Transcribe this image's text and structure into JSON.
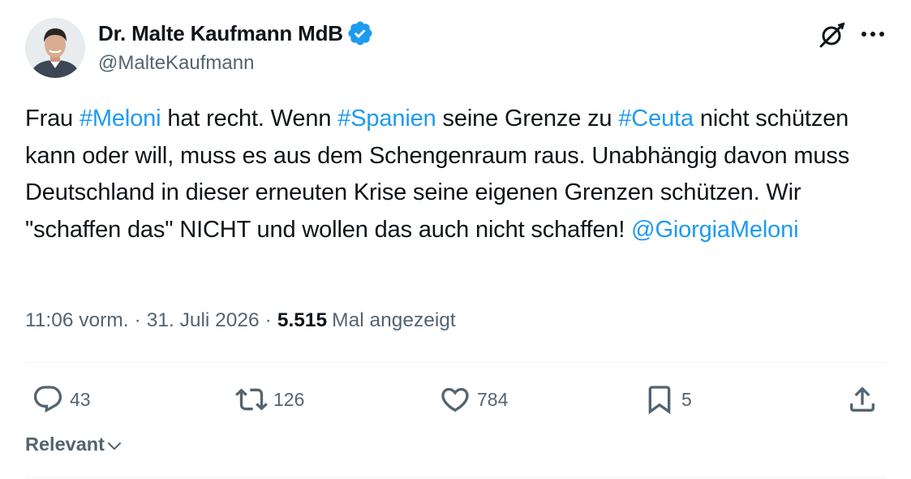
{
  "author": {
    "display_name": "Dr. Malte Kaufmann MdB",
    "handle": "@MalteKaufmann",
    "verified_icon": "verified-badge-icon"
  },
  "header_actions": {
    "grok_icon": "grok-icon",
    "more_icon": "more-options-icon"
  },
  "tweet": {
    "segments": [
      {
        "text": "Frau ",
        "type": "text"
      },
      {
        "text": "#Meloni",
        "type": "hashtag"
      },
      {
        "text": " hat recht. Wenn ",
        "type": "text"
      },
      {
        "text": "#Spanien",
        "type": "hashtag"
      },
      {
        "text": " seine Grenze zu ",
        "type": "text"
      },
      {
        "text": "#Ceuta",
        "type": "hashtag"
      },
      {
        "text": " nicht schützen kann oder will, muss es aus dem Schengenraum raus. Unabhängig davon muss Deutschland in dieser erneuten Krise seine eigenen Grenzen schützen. Wir \"schaffen das\" NICHT und wollen das auch nicht schaffen! ",
        "type": "text"
      },
      {
        "text": "@GiorgiaMeloni",
        "type": "mention"
      }
    ]
  },
  "meta": {
    "time": "11:06 vorm.",
    "date": "31. Juli 2026",
    "views_count": "5.515",
    "views_label": "Mal angezeigt",
    "separator": "·"
  },
  "actions": {
    "reply_count": "43",
    "retweet_count": "126",
    "like_count": "784",
    "bookmark_count": "5"
  },
  "sort": {
    "label": "Relevant"
  },
  "colors": {
    "link": "#1d9bf0",
    "text": "#0f1419",
    "secondary": "#536471",
    "verified": "#1d9bf0"
  }
}
